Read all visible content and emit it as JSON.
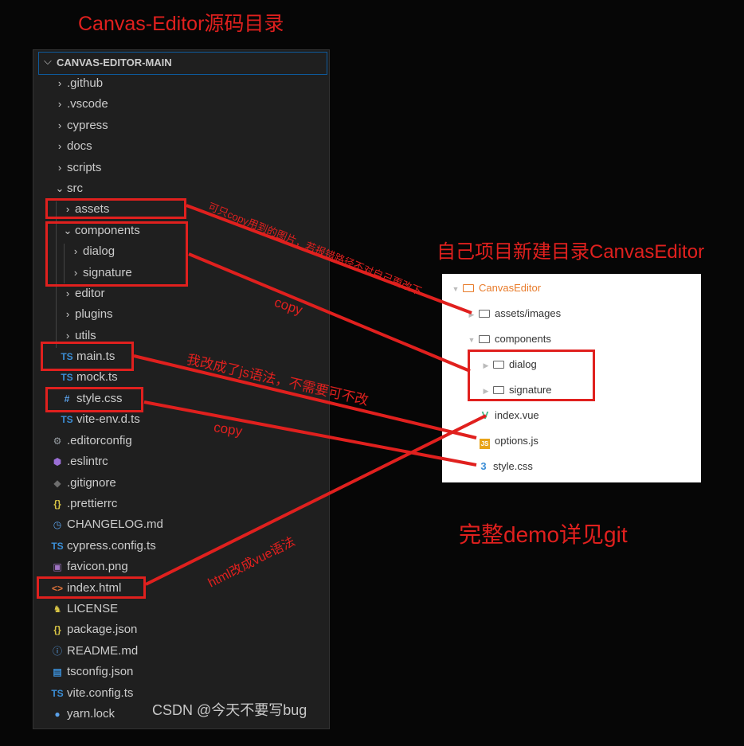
{
  "titles": {
    "left": "Canvas-Editor源码目录",
    "right": "自己项目新建目录CanvasEditor",
    "demo": "完整demo详见git"
  },
  "explorer": {
    "root": "CANVAS-EDITOR-MAIN",
    "items": [
      {
        "label": ".github",
        "icon": "chevron-right-icon"
      },
      {
        "label": ".vscode",
        "icon": "chevron-right-icon"
      },
      {
        "label": "cypress",
        "icon": "chevron-right-icon"
      },
      {
        "label": "docs",
        "icon": "chevron-right-icon"
      },
      {
        "label": "scripts",
        "icon": "chevron-right-icon"
      },
      {
        "label": "src",
        "icon": "chevron-down-icon"
      },
      {
        "label": "assets",
        "icon": "chevron-right-icon"
      },
      {
        "label": "components",
        "icon": "chevron-down-icon"
      },
      {
        "label": "dialog",
        "icon": "chevron-right-icon"
      },
      {
        "label": "signature",
        "icon": "chevron-right-icon"
      },
      {
        "label": "editor",
        "icon": "chevron-right-icon"
      },
      {
        "label": "plugins",
        "icon": "chevron-right-icon"
      },
      {
        "label": "utils",
        "icon": "chevron-right-icon"
      },
      {
        "label": "main.ts",
        "icon": "typescript-icon"
      },
      {
        "label": "mock.ts",
        "icon": "typescript-icon"
      },
      {
        "label": "style.css",
        "icon": "css-hash-icon"
      },
      {
        "label": "vite-env.d.ts",
        "icon": "typescript-icon"
      },
      {
        "label": ".editorconfig",
        "icon": "gear-icon"
      },
      {
        "label": ".eslintrc",
        "icon": "eslint-icon"
      },
      {
        "label": ".gitignore",
        "icon": "git-icon"
      },
      {
        "label": ".prettierrc",
        "icon": "braces-icon"
      },
      {
        "label": "CHANGELOG.md",
        "icon": "clock-icon"
      },
      {
        "label": "cypress.config.ts",
        "icon": "typescript-icon"
      },
      {
        "label": "favicon.png",
        "icon": "image-icon"
      },
      {
        "label": "index.html",
        "icon": "html-icon"
      },
      {
        "label": "LICENSE",
        "icon": "license-icon"
      },
      {
        "label": "package.json",
        "icon": "braces-icon"
      },
      {
        "label": "README.md",
        "icon": "info-icon"
      },
      {
        "label": "tsconfig.json",
        "icon": "tsconfig-icon"
      },
      {
        "label": "vite.config.ts",
        "icon": "typescript-icon"
      },
      {
        "label": "yarn.lock",
        "icon": "yarn-icon"
      }
    ]
  },
  "icon_glyphs": {
    "ts": "TS",
    "hash": "#",
    "braces": "{}",
    "html": "<>",
    "js": "JS",
    "vue": "V",
    "css": "3"
  },
  "panel": {
    "root": "CanvasEditor",
    "items": [
      {
        "label": "assets/images",
        "icon": "folder-icon"
      },
      {
        "label": "components",
        "icon": "folder-icon"
      },
      {
        "label": "dialog",
        "icon": "folder-icon"
      },
      {
        "label": "signature",
        "icon": "folder-icon"
      },
      {
        "label": "index.vue",
        "icon": "vue-icon"
      },
      {
        "label": "options.js",
        "icon": "js-icon"
      },
      {
        "label": "style.css",
        "icon": "css-icon"
      }
    ]
  },
  "annotations": {
    "assets_note": "可只copy用到的图片，若报错路径不对自己更改下",
    "components_copy": "copy",
    "main_note": "我改成了js语法，不需要可不改",
    "style_copy": "copy",
    "html_note": "html改成vue语法"
  },
  "watermark": "CSDN @今天不要写bug",
  "colors": {
    "annotation_red": "#e0201e",
    "explorer_bg": "#1f1f1f",
    "panel_bg": "#ffffff",
    "accent_orange": "#e87b2a"
  }
}
